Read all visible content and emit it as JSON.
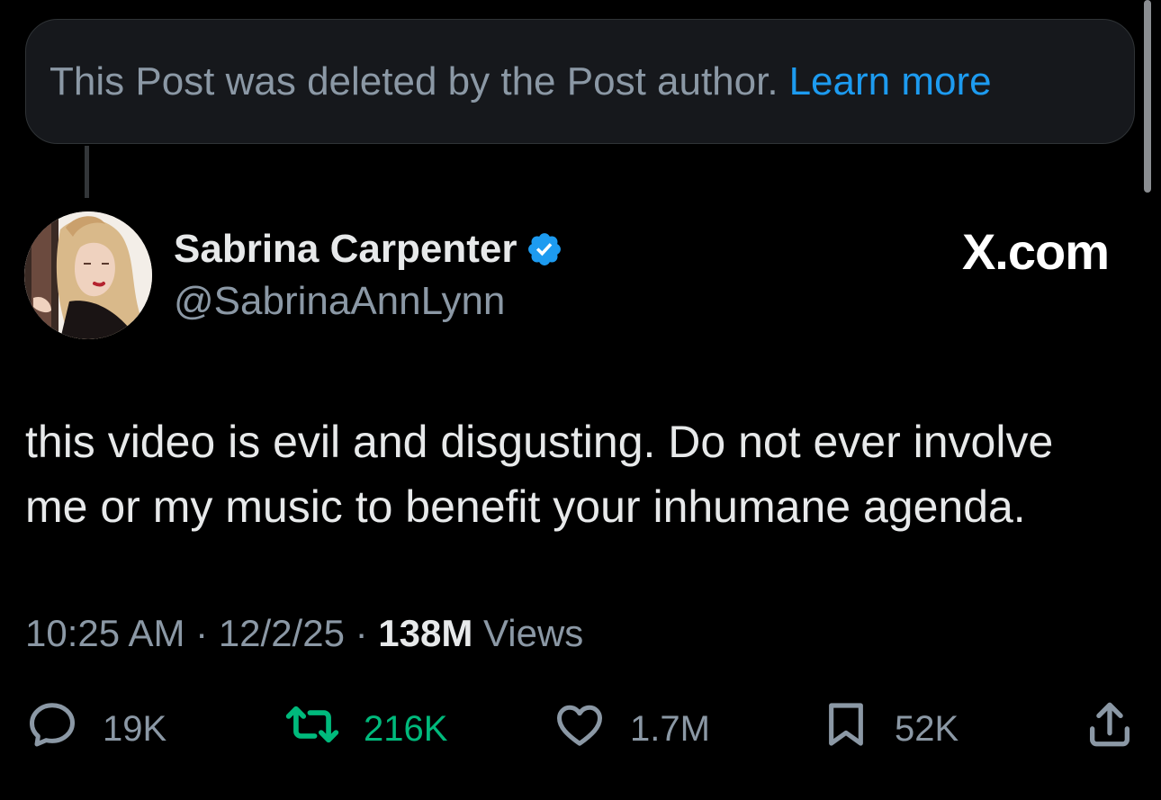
{
  "banner": {
    "text": "This Post was deleted by the Post author.",
    "link": "Learn more"
  },
  "author": {
    "display_name": "Sabrina Carpenter",
    "handle": "@SabrinaAnnLynn",
    "verified": true
  },
  "brand": "X.com",
  "post": {
    "lines": [
      "this video is evil and disgusting. Do not ever involve",
      "me or my music to benefit your inhumane agenda."
    ]
  },
  "meta": {
    "time": "10:25 AM",
    "separator": "·",
    "date": "12/2/25",
    "views_count": "138M",
    "views_label": "Views"
  },
  "actions": {
    "replies": "19K",
    "reposts": "216K",
    "likes": "1.7M",
    "bookmarks": "52K"
  },
  "icons": {
    "reply": "reply-icon",
    "repost": "repost-icon",
    "like": "heart-icon",
    "bookmark": "bookmark-icon",
    "share": "share-icon",
    "verified": "verified-badge-icon"
  },
  "colors": {
    "background": "#000000",
    "text": "#e7e9ea",
    "secondary": "#8b98a5",
    "link": "#1d9bf0",
    "repost": "#00ba7c",
    "banner": "#16181c"
  }
}
